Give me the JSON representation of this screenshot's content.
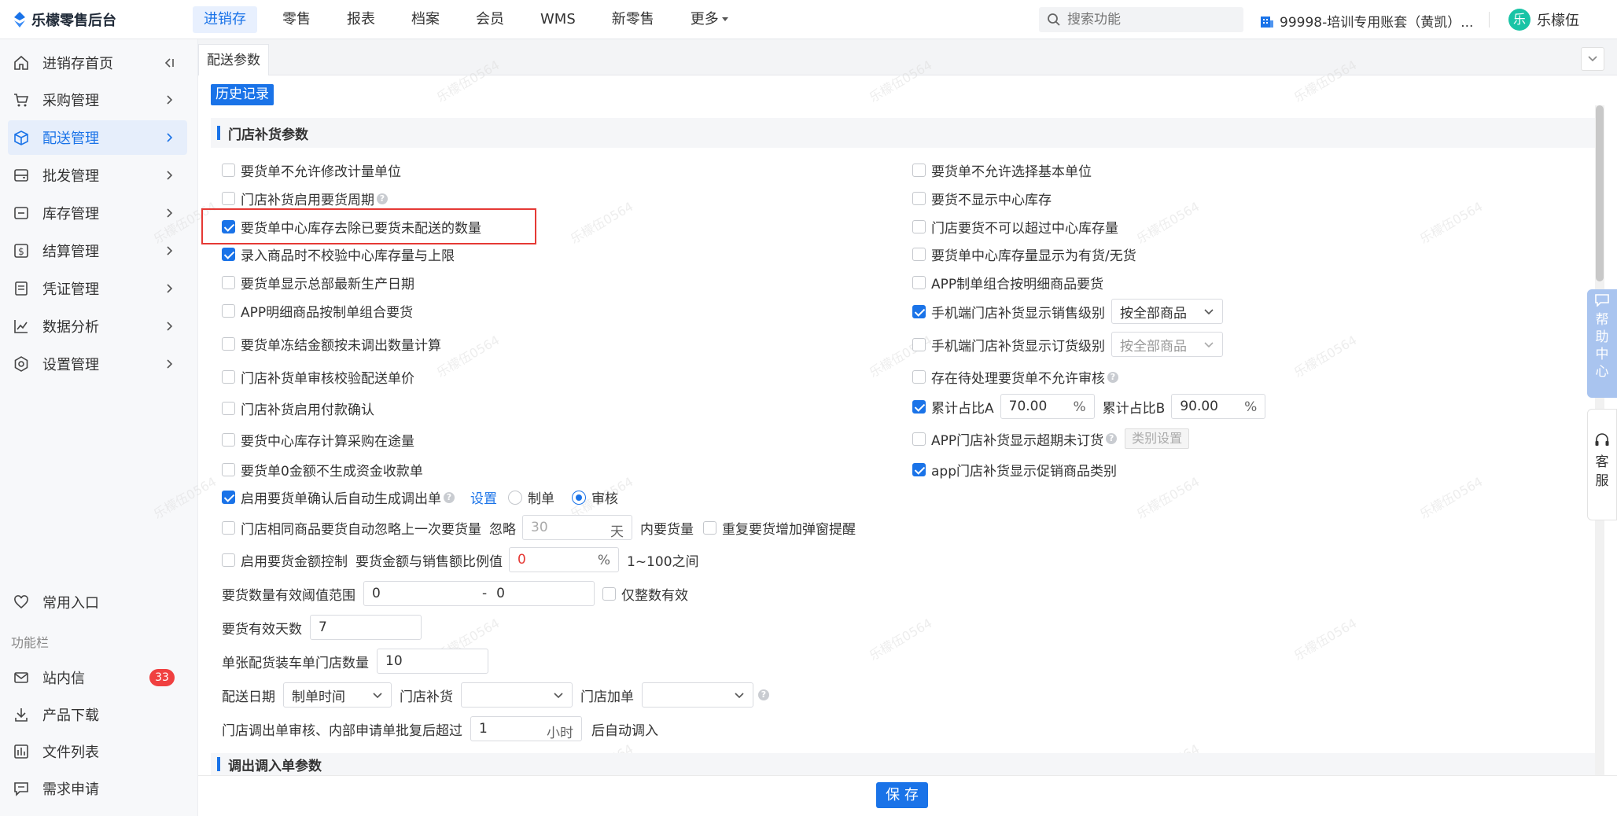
{
  "app": {
    "logo_text": "乐檬零售后台",
    "brand_color": "#1a73e8"
  },
  "nav": {
    "items": [
      "进销存",
      "零售",
      "报表",
      "档案",
      "会员",
      "WMS",
      "新零售",
      "更多"
    ],
    "active": "进销存"
  },
  "search": {
    "placeholder": "搜索功能"
  },
  "account": {
    "label": "99998-培训专用账套（黄凯）..."
  },
  "user": {
    "avatar_char": "乐",
    "name": "乐檬伍"
  },
  "sidebar": {
    "items": [
      {
        "label": "进销存首页",
        "icon": "home-icon"
      },
      {
        "label": "采购管理",
        "icon": "cart-icon"
      },
      {
        "label": "配送管理",
        "icon": "delivery-icon"
      },
      {
        "label": "批发管理",
        "icon": "wholesale-icon"
      },
      {
        "label": "库存管理",
        "icon": "inventory-icon"
      },
      {
        "label": "结算管理",
        "icon": "settlement-icon"
      },
      {
        "label": "凭证管理",
        "icon": "voucher-icon"
      },
      {
        "label": "数据分析",
        "icon": "analytics-icon"
      },
      {
        "label": "设置管理",
        "icon": "settings-icon"
      }
    ],
    "active": "配送管理",
    "favorites_label": "常用入口",
    "toolbar_label": "功能栏",
    "tools": [
      {
        "label": "站内信",
        "badge": "33"
      },
      {
        "label": "产品下载"
      },
      {
        "label": "文件列表"
      },
      {
        "label": "需求申请"
      }
    ]
  },
  "tab": {
    "label": "配送参数"
  },
  "history_button": "历史记录",
  "section1": {
    "title": "门店补货参数"
  },
  "section2": {
    "title": "调出调入单参数"
  },
  "left_options": [
    {
      "label": "要货单不允许修改计量单位",
      "checked": false
    },
    {
      "label": "门店补货启用要货周期",
      "checked": false,
      "help": true
    },
    {
      "label": "要货单中心库存去除已要货未配送的数量",
      "checked": true
    },
    {
      "label": "录入商品时不校验中心库存量与上限",
      "checked": true
    },
    {
      "label": "要货单显示总部最新生产日期",
      "checked": false
    },
    {
      "label": "APP明细商品按制单组合要货",
      "checked": false
    },
    {
      "label": "要货单冻结金额按未调出数量计算",
      "checked": false
    },
    {
      "label": "门店补货单审核校验配送单价",
      "checked": false
    },
    {
      "label": "门店补货启用付款确认",
      "checked": false
    },
    {
      "label": "要货中心库存计算采购在途量",
      "checked": false
    },
    {
      "label": "要货单0金额不生成资金收款单",
      "checked": false
    }
  ],
  "auto_gen": {
    "label": "启用要货单确认后自动生成调出单",
    "checked": true,
    "link": "设置",
    "radio_options": [
      "制单",
      "审核"
    ],
    "radio_selected": "审核"
  },
  "ignore_prev": {
    "label": "门店相同商品要货自动忽略上一次要货量",
    "prefix": "忽略",
    "value_placeholder": "30",
    "unit": "天",
    "suffix": "内要货量",
    "repeat_label": "重复要货增加弹窗提醒"
  },
  "amount_ctrl": {
    "label": "启用要货金额控制",
    "ratio_label": "要货金额与销售额比例值",
    "value": "0",
    "unit": "%",
    "range_text": "1~100之间"
  },
  "qty_threshold": {
    "label": "要货数量有效阈值范围",
    "min": "0",
    "sep": "-",
    "max": "0",
    "integer_label": "仅整数有效"
  },
  "valid_days": {
    "label": "要货有效天数",
    "value": "7"
  },
  "truck_count": {
    "label": "单张配货装车单门店数量",
    "value": "10"
  },
  "delivery_date": {
    "label": "配送日期",
    "value": "制单时间",
    "replenish_label": "门店补货",
    "add_label": "门店加单"
  },
  "auto_in": {
    "label": "门店调出单审核、内部申请单批复后超过",
    "value": "1",
    "unit": "小时",
    "suffix": "后自动调入"
  },
  "right_options": [
    {
      "label": "要货单不允许选择基本单位",
      "checked": false
    },
    {
      "label": "要货不显示中心库存",
      "checked": false
    },
    {
      "label": "门店要货不可以超过中心库存量",
      "checked": false
    },
    {
      "label": "要货单中心库存量显示为有货/无货",
      "checked": false
    },
    {
      "label": "APP制单组合按明细商品要货",
      "checked": false
    }
  ],
  "mobile_sales": {
    "label": "手机端门店补货显示销售级别",
    "checked": true,
    "select": "按全部商品"
  },
  "mobile_order": {
    "label": "手机端门店补货显示订货级别",
    "checked": false,
    "select": "按全部商品"
  },
  "pending_audit": {
    "label": "存在待处理要货单不允许审核",
    "checked": false
  },
  "cumulative": {
    "label_a": "累计占比A",
    "value_a": "70.00",
    "label_b": "累计占比B",
    "value_b": "90.00",
    "unit": "%",
    "checked": true
  },
  "app_overdue": {
    "label": "APP门店补货显示超期未订货",
    "checked": false,
    "button": "类别设置"
  },
  "app_promo": {
    "label": "app门店补货显示促销商品类别",
    "checked": true
  },
  "save_button": "保 存",
  "help_center": "帮助中心",
  "customer_service": "客服",
  "watermark": "乐檬伍0564"
}
